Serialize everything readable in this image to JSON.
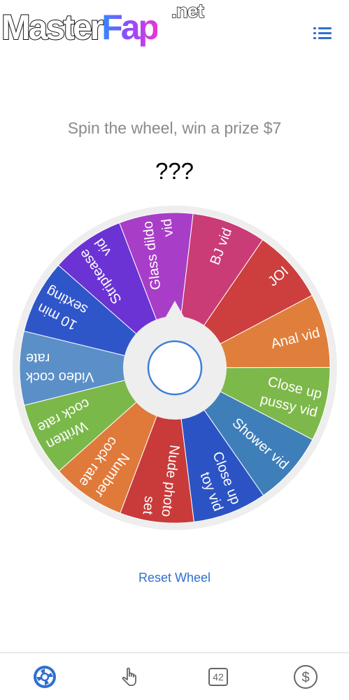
{
  "watermark": {
    "logo_main": "Master",
    "logo_accent": "Fap",
    "logo_suffix": ".net"
  },
  "header": {
    "menu_icon": "list-menu-icon"
  },
  "title": "Spin the wheel, win a prize $7",
  "result": "???",
  "wheel": {
    "segments": [
      {
        "lines": [
          "Video cock",
          "rate"
        ],
        "color": "#5b8fc7"
      },
      {
        "lines": [
          "10 min",
          "sexting"
        ],
        "color": "#2f56c9"
      },
      {
        "lines": [
          "Striptease",
          "vid"
        ],
        "color": "#6b33d4"
      },
      {
        "lines": [
          "Glass dildo",
          "vid"
        ],
        "color": "#a83ec8"
      },
      {
        "lines": [
          "BJ vid"
        ],
        "color": "#c93c76"
      },
      {
        "lines": [
          "JOI"
        ],
        "color": "#cd3e3e"
      },
      {
        "lines": [
          "Anal vid"
        ],
        "color": "#df7f3b"
      },
      {
        "lines": [
          "Close up",
          "pussy vid"
        ],
        "color": "#7db84a"
      },
      {
        "lines": [
          "Shower vid"
        ],
        "color": "#3f7fb9"
      },
      {
        "lines": [
          "Close up",
          "toy vid"
        ],
        "color": "#2b53c4"
      },
      {
        "lines": [
          "Nude photo",
          "set"
        ],
        "color": "#c93a3a"
      },
      {
        "lines": [
          "Number",
          "cock rate"
        ],
        "color": "#e07a3a"
      },
      {
        "lines": [
          "Written",
          "cock rate"
        ],
        "color": "#7ab84a"
      }
    ],
    "rim_color": "#eeeeee",
    "hub_ring_color": "#3b7fd8"
  },
  "reset_label": "Reset Wheel",
  "tabs": [
    {
      "icon": "wheel-icon",
      "active": true
    },
    {
      "icon": "tap-hand-icon",
      "active": false
    },
    {
      "icon": "number-icon",
      "label": "42",
      "active": false
    },
    {
      "icon": "dollar-icon",
      "active": false
    }
  ],
  "colors": {
    "accent": "#2f6fd0",
    "inactive_icon": "#666666"
  }
}
